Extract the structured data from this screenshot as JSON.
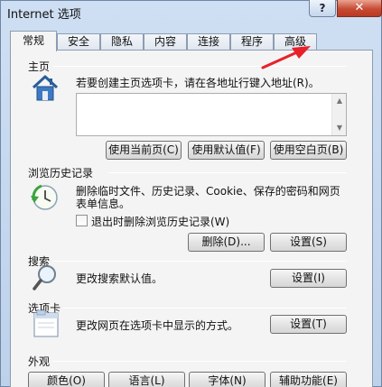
{
  "window": {
    "title": "Internet 选项",
    "help_label": "?",
    "close_label": "✕"
  },
  "tabs": [
    {
      "label": "常规",
      "active": true
    },
    {
      "label": "安全"
    },
    {
      "label": "隐私"
    },
    {
      "label": "内容"
    },
    {
      "label": "连接"
    },
    {
      "label": "程序"
    },
    {
      "label": "高级"
    }
  ],
  "homepage": {
    "title": "主页",
    "description": "若要创建主页选项卡，请在各地址行键入地址(R)。",
    "address_value": "",
    "buttons": {
      "use_current": "使用当前页(C)",
      "use_default": "使用默认值(F)",
      "use_blank": "使用空白页(B)"
    }
  },
  "history": {
    "title": "浏览历史记录",
    "description_line1": "删除临时文件、历史记录、Cookie、保存的密码和网页",
    "description_line2": "表单信息。",
    "checkbox_label": "退出时删除浏览历史记录(W)",
    "checkbox_checked": false,
    "buttons": {
      "delete": "删除(D)...",
      "settings": "设置(S)"
    }
  },
  "search": {
    "title": "搜索",
    "description": "更改搜索默认值。",
    "settings_button": "设置(I)"
  },
  "tabs_section": {
    "title": "选项卡",
    "description": "更改网页在选项卡中显示的方式。",
    "settings_button": "设置(T)"
  },
  "appearance": {
    "title": "外观",
    "buttons": {
      "colors": "颜色(O)",
      "languages": "语言(L)",
      "fonts": "字体(N)",
      "accessibility": "辅助功能(E)"
    }
  },
  "colors": {
    "annotation_arrow": "#e8202a",
    "window_frame": "#bdd1ea",
    "panel": "#f4f4f4"
  }
}
